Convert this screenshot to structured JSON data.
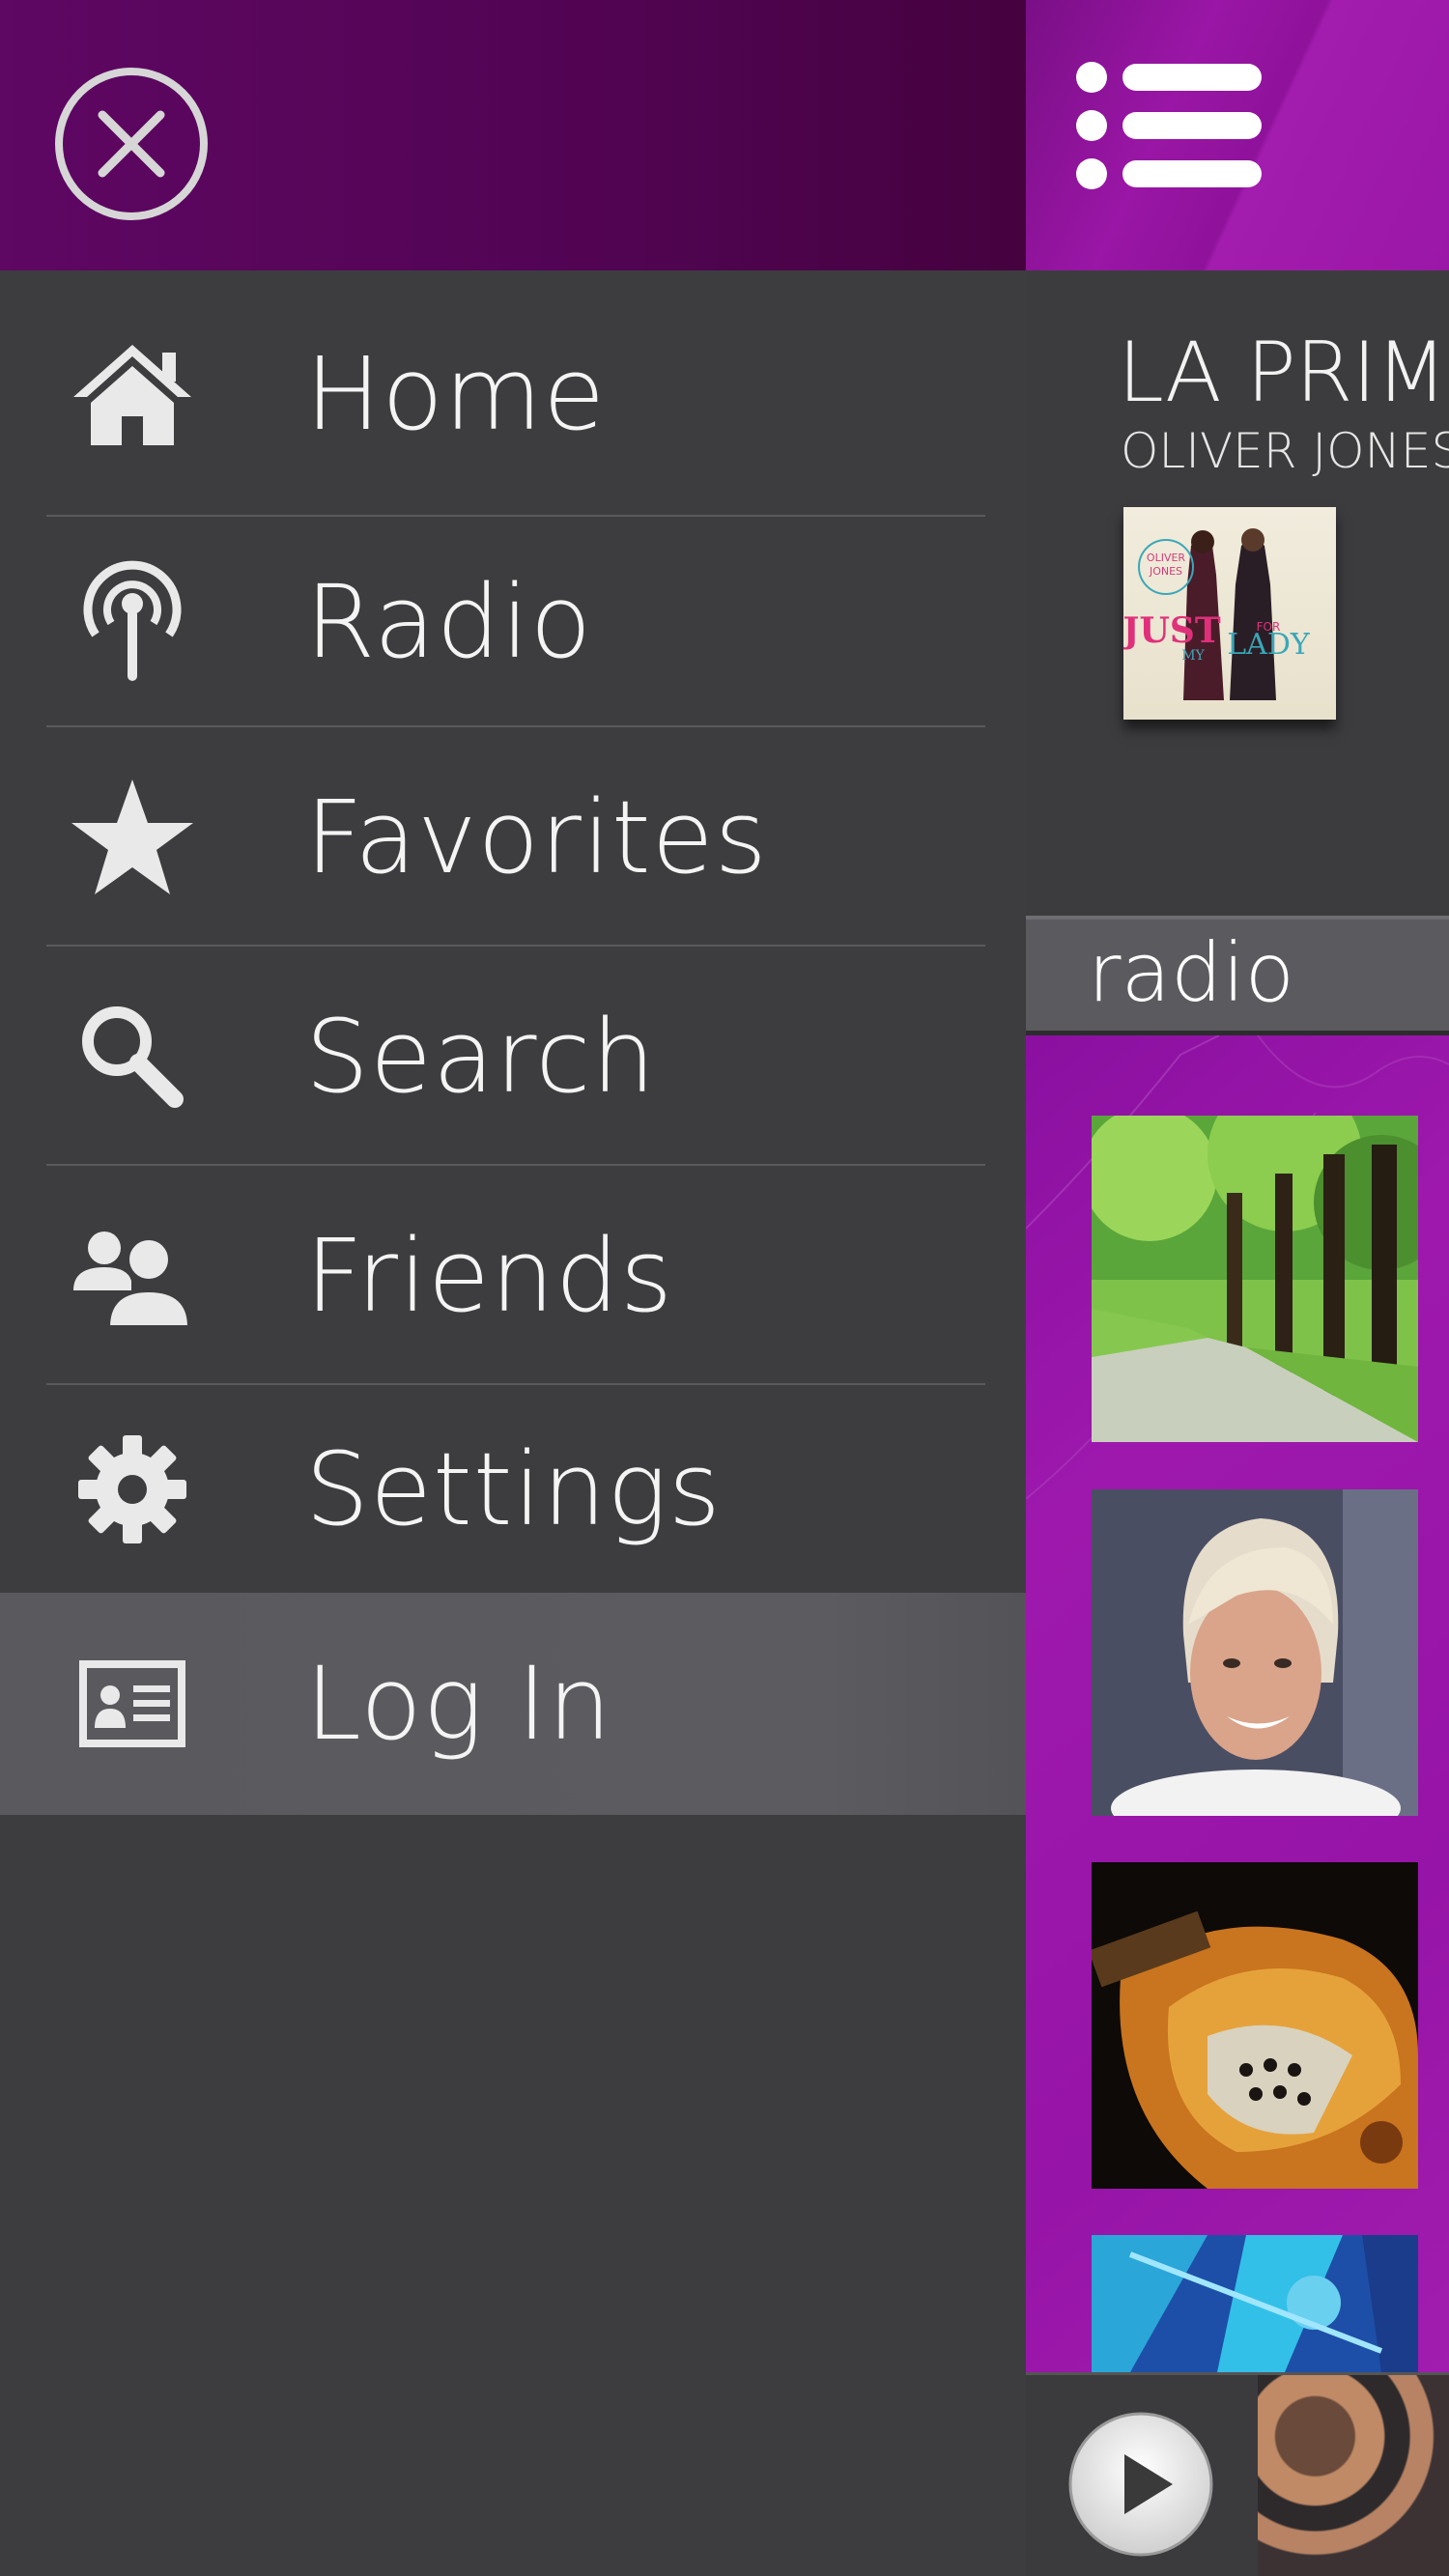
{
  "drawer": {
    "close_icon": "close-circle-icon",
    "items": [
      {
        "label": "Home",
        "icon": "home-icon"
      },
      {
        "label": "Radio",
        "icon": "radio-antenna-icon"
      },
      {
        "label": "Favorites",
        "icon": "star-icon"
      },
      {
        "label": "Search",
        "icon": "search-icon"
      },
      {
        "label": "Friends",
        "icon": "friends-icon"
      },
      {
        "label": "Settings",
        "icon": "gear-icon"
      },
      {
        "label": "Log In",
        "icon": "id-card-icon",
        "active": true
      }
    ]
  },
  "content": {
    "menu_icon": "list-menu-icon",
    "now_playing": {
      "title": "LA PRIM",
      "artist": "OLIVER JONES",
      "album_text": [
        "OLIVER",
        "JONES",
        "JUST",
        "FOR",
        "MY",
        "LADY"
      ]
    },
    "section_label": "radio",
    "stations": [
      "forest-path-photo",
      "blonde-woman-portrait",
      "guitar-closeup-photo",
      "concert-lights-photo"
    ],
    "player": {
      "play_icon": "play-icon"
    }
  },
  "colors": {
    "header_purple": "#510452",
    "accent_purple": "#9a16a6",
    "drawer_bg": "#3d3d40",
    "active_item_bg": "#5a5a5e",
    "text": "#f4f4f4"
  }
}
